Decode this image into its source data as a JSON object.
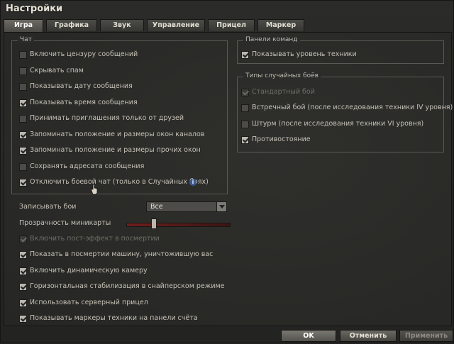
{
  "window": {
    "title": "Настройки"
  },
  "tabs": [
    {
      "label": "Игра",
      "active": true
    },
    {
      "label": "Графика",
      "active": false
    },
    {
      "label": "Звук",
      "active": false
    },
    {
      "label": "Управление",
      "active": false
    },
    {
      "label": "Прицел",
      "active": false
    },
    {
      "label": "Маркер",
      "active": false
    }
  ],
  "chat": {
    "title": "Чат",
    "items": [
      {
        "label": "Включить цензуру сообщений",
        "checked": false
      },
      {
        "label": "Скрывать спам",
        "checked": false
      },
      {
        "label": "Показывать дату сообщения",
        "checked": false
      },
      {
        "label": "Показывать время сообщения",
        "checked": true
      },
      {
        "label": "Принимать приглашения только от друзей",
        "checked": false
      },
      {
        "label": "Запоминать положение и размеры окон каналов",
        "checked": true
      },
      {
        "label": "Запоминать положение и размеры прочих окон",
        "checked": true
      },
      {
        "label": "Сохранять адресата сообщения",
        "checked": false
      },
      {
        "label": "Отключить боевой чат (только в Случайных боях)",
        "checked": true
      }
    ],
    "info_icon": "info-icon"
  },
  "command_panel": {
    "title": "Панели команд",
    "items": [
      {
        "label": "Показывать уровень техники",
        "checked": true
      }
    ]
  },
  "battle_types": {
    "title": "Типы случайных боёв",
    "items": [
      {
        "label": "Стандартный бой",
        "checked": true,
        "disabled": true
      },
      {
        "label": "Встречный бой (после исследования техники IV уровня)",
        "checked": false
      },
      {
        "label": "Штурм (после исследования техники VI уровня)",
        "checked": false
      },
      {
        "label": "Противостояние",
        "checked": true
      }
    ]
  },
  "record": {
    "label": "Записывать бои",
    "value": "Все"
  },
  "minimap": {
    "label": "Прозрачность миникарты",
    "level_percent": 25
  },
  "bottom_options": [
    {
      "label": "Включить пост-эффект в посмертии",
      "checked": true,
      "disabled": true
    },
    {
      "label": "Показать в посмертии машину, уничтожившую вас",
      "checked": true
    },
    {
      "label": "Включить динамическую камеру",
      "checked": true
    },
    {
      "label": "Горизонтальная стабилизация в снайперском режиме",
      "checked": true
    },
    {
      "label": "Использовать серверный прицел",
      "checked": true
    },
    {
      "label": "Показывать маркеры техники на панели счёта",
      "checked": true
    }
  ],
  "buttons": {
    "ok": "OK",
    "cancel": "Отменить",
    "apply": "Применить"
  }
}
